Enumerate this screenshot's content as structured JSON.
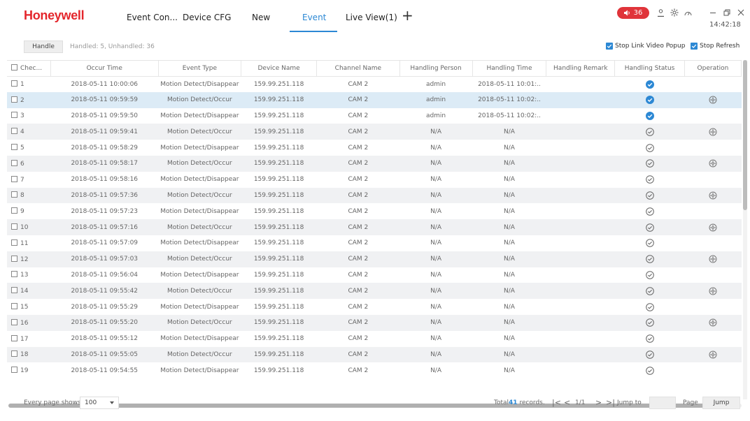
{
  "app": {
    "brand": "Honeywell",
    "tabs": [
      {
        "label": "Event Con..."
      },
      {
        "label": "Device CFG"
      },
      {
        "label": "New"
      },
      {
        "label": "Event"
      },
      {
        "label": "Live View(1)"
      }
    ],
    "active_tab": "Event",
    "alarm_count": "36",
    "clock": "14:42:18",
    "icons": [
      "alarm-speaker-icon",
      "user-icon",
      "settings-icon",
      "dashboard-icon",
      "minimize-icon",
      "restore-icon",
      "close-icon",
      "add-tab-icon"
    ]
  },
  "toolbar": {
    "handle_label": "Handle",
    "handled_info": "Handled: 5, Unhandled: 36",
    "stop_link_label": "Stop Link Video Popup",
    "stop_link_checked": true,
    "stop_refresh_label": "Stop Refresh",
    "stop_refresh_checked": true
  },
  "table": {
    "columns": [
      "Chec...",
      "Occur Time",
      "Event Type",
      "Device Name",
      "Channel Name",
      "Handling Person",
      "Handling Time",
      "Handling Remark",
      "Handling Status",
      "Operation"
    ],
    "rows": [
      {
        "no": "1",
        "time": "2018-05-11 10:00:06",
        "type": "Motion Detect/Disappear",
        "device": "159.99.251.118",
        "channel": "CAM 2",
        "person": "admin",
        "htime": "2018-05-11 10:01:..",
        "remark": "",
        "status": "handled",
        "op": false
      },
      {
        "no": "2",
        "time": "2018-05-11 09:59:59",
        "type": "Motion Detect/Occur",
        "device": "159.99.251.118",
        "channel": "CAM 2",
        "person": "admin",
        "htime": "2018-05-11 10:02:..",
        "remark": "",
        "status": "handled",
        "op": true
      },
      {
        "no": "3",
        "time": "2018-05-11 09:59:50",
        "type": "Motion Detect/Disappear",
        "device": "159.99.251.118",
        "channel": "CAM 2",
        "person": "admin",
        "htime": "2018-05-11 10:02:..",
        "remark": "",
        "status": "handled",
        "op": false
      },
      {
        "no": "4",
        "time": "2018-05-11 09:59:41",
        "type": "Motion Detect/Occur",
        "device": "159.99.251.118",
        "channel": "CAM 2",
        "person": "N/A",
        "htime": "N/A",
        "remark": "",
        "status": "unhandled",
        "op": true
      },
      {
        "no": "5",
        "time": "2018-05-11 09:58:29",
        "type": "Motion Detect/Disappear",
        "device": "159.99.251.118",
        "channel": "CAM 2",
        "person": "N/A",
        "htime": "N/A",
        "remark": "",
        "status": "unhandled",
        "op": false
      },
      {
        "no": "6",
        "time": "2018-05-11 09:58:17",
        "type": "Motion Detect/Occur",
        "device": "159.99.251.118",
        "channel": "CAM 2",
        "person": "N/A",
        "htime": "N/A",
        "remark": "",
        "status": "unhandled",
        "op": true
      },
      {
        "no": "7",
        "time": "2018-05-11 09:58:16",
        "type": "Motion Detect/Disappear",
        "device": "159.99.251.118",
        "channel": "CAM 2",
        "person": "N/A",
        "htime": "N/A",
        "remark": "",
        "status": "unhandled",
        "op": false
      },
      {
        "no": "8",
        "time": "2018-05-11 09:57:36",
        "type": "Motion Detect/Occur",
        "device": "159.99.251.118",
        "channel": "CAM 2",
        "person": "N/A",
        "htime": "N/A",
        "remark": "",
        "status": "unhandled",
        "op": true
      },
      {
        "no": "9",
        "time": "2018-05-11 09:57:23",
        "type": "Motion Detect/Disappear",
        "device": "159.99.251.118",
        "channel": "CAM 2",
        "person": "N/A",
        "htime": "N/A",
        "remark": "",
        "status": "unhandled",
        "op": false
      },
      {
        "no": "10",
        "time": "2018-05-11 09:57:16",
        "type": "Motion Detect/Occur",
        "device": "159.99.251.118",
        "channel": "CAM 2",
        "person": "N/A",
        "htime": "N/A",
        "remark": "",
        "status": "unhandled",
        "op": true
      },
      {
        "no": "11",
        "time": "2018-05-11 09:57:09",
        "type": "Motion Detect/Disappear",
        "device": "159.99.251.118",
        "channel": "CAM 2",
        "person": "N/A",
        "htime": "N/A",
        "remark": "",
        "status": "unhandled",
        "op": false
      },
      {
        "no": "12",
        "time": "2018-05-11 09:57:03",
        "type": "Motion Detect/Occur",
        "device": "159.99.251.118",
        "channel": "CAM 2",
        "person": "N/A",
        "htime": "N/A",
        "remark": "",
        "status": "unhandled",
        "op": true
      },
      {
        "no": "13",
        "time": "2018-05-11 09:56:04",
        "type": "Motion Detect/Disappear",
        "device": "159.99.251.118",
        "channel": "CAM 2",
        "person": "N/A",
        "htime": "N/A",
        "remark": "",
        "status": "unhandled",
        "op": false
      },
      {
        "no": "14",
        "time": "2018-05-11 09:55:42",
        "type": "Motion Detect/Occur",
        "device": "159.99.251.118",
        "channel": "CAM 2",
        "person": "N/A",
        "htime": "N/A",
        "remark": "",
        "status": "unhandled",
        "op": true
      },
      {
        "no": "15",
        "time": "2018-05-11 09:55:29",
        "type": "Motion Detect/Disappear",
        "device": "159.99.251.118",
        "channel": "CAM 2",
        "person": "N/A",
        "htime": "N/A",
        "remark": "",
        "status": "unhandled",
        "op": false
      },
      {
        "no": "16",
        "time": "2018-05-11 09:55:20",
        "type": "Motion Detect/Occur",
        "device": "159.99.251.118",
        "channel": "CAM 2",
        "person": "N/A",
        "htime": "N/A",
        "remark": "",
        "status": "unhandled",
        "op": true
      },
      {
        "no": "17",
        "time": "2018-05-11 09:55:12",
        "type": "Motion Detect/Disappear",
        "device": "159.99.251.118",
        "channel": "CAM 2",
        "person": "N/A",
        "htime": "N/A",
        "remark": "",
        "status": "unhandled",
        "op": false
      },
      {
        "no": "18",
        "time": "2018-05-11 09:55:05",
        "type": "Motion Detect/Occur",
        "device": "159.99.251.118",
        "channel": "CAM 2",
        "person": "N/A",
        "htime": "N/A",
        "remark": "",
        "status": "unhandled",
        "op": true
      },
      {
        "no": "19",
        "time": "2018-05-11 09:54:55",
        "type": "Motion Detect/Disappear",
        "device": "159.99.251.118",
        "channel": "CAM 2",
        "person": "N/A",
        "htime": "N/A",
        "remark": "",
        "status": "unhandled",
        "op": false
      }
    ],
    "selected_row": "2"
  },
  "footer": {
    "per_page_label": "Every page shows",
    "per_page_value": "100",
    "total_prefix": "Total",
    "total_count": "41",
    "total_suffix": "records.",
    "page_indicator": "1/1",
    "jump_to_label": "Jump to",
    "page_label": "Page",
    "jump_button": "Jump"
  },
  "colors": {
    "brand": "#e4262c",
    "accent": "#2c88d4",
    "alarm": "#e0343a",
    "selected_row": "#dcebf6"
  }
}
